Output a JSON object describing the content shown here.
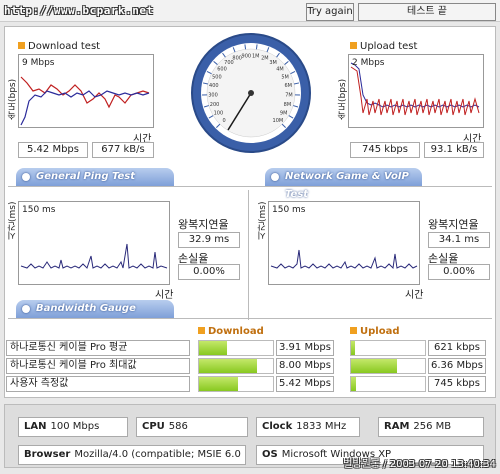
{
  "header": {
    "url": "http://www.bcpark.net",
    "try_again": "Try again",
    "test_end": "테스트 끝"
  },
  "download": {
    "title": "Download test",
    "axis_unit": "속도(bps)",
    "scale_label": "9 Mbps",
    "time_label": "시간",
    "mbps": "5.42 Mbps",
    "kbs": "677 kB/s"
  },
  "upload": {
    "title": "Upload test",
    "axis_unit": "속도(bps)",
    "scale_label": "2 Mbps",
    "time_label": "시간",
    "kbps": "745 kbps",
    "kbs": "93.1 kB/s"
  },
  "gauge": {
    "ticks": [
      "0",
      "100",
      "200",
      "300",
      "400",
      "500",
      "600",
      "700",
      "800",
      "900",
      "1M",
      "2M",
      "3M",
      "4M",
      "5M",
      "6M",
      "7M",
      "8M",
      "9M",
      "10M"
    ],
    "needle_value": "5M"
  },
  "ping": {
    "tab_label": "General Ping Test",
    "axis_unit": "시간(ms)",
    "scale_label": "150 ms",
    "time_label": "시간",
    "rtt_label": "왕복지연율",
    "rtt_value": "32.9 ms",
    "loss_label": "손실율",
    "loss_value": "0.00%"
  },
  "game": {
    "tab_label": "Network Game & VoIP Test",
    "axis_unit": "시간(ms)",
    "scale_label": "150 ms",
    "time_label": "시간",
    "rtt_label": "왕복지연율",
    "rtt_value": "34.1 ms",
    "loss_label": "손실율",
    "loss_value": "0.00%"
  },
  "bandwidth": {
    "tab_label": "Bandwidth Gauge",
    "download_header": "Download",
    "upload_header": "Upload",
    "rows": [
      {
        "label": "하나로통신 케이블 Pro 평균",
        "down": "3.91 Mbps",
        "down_fill": 0.38,
        "up": "621 kbps",
        "up_fill": 0.06
      },
      {
        "label": "하나로통신 케이블 Pro 최대값",
        "down": "8.00 Mbps",
        "down_fill": 0.78,
        "up": "6.36 Mbps",
        "up_fill": 0.62
      },
      {
        "label": "사용자 측정값",
        "down": "5.42 Mbps",
        "down_fill": 0.53,
        "up": "745 kbps",
        "up_fill": 0.07
      }
    ]
  },
  "system": {
    "lan_label": "LAN",
    "lan_value": "100 Mbps",
    "cpu_label": "CPU",
    "cpu_value": "586",
    "clock_label": "Clock",
    "clock_value": "1833 MHz",
    "ram_label": "RAM",
    "ram_value": "256 MB",
    "browser_label": "Browser",
    "browser_value": "Mozilla/4.0 (compatible; MSIE 6.0",
    "os_label": "OS",
    "os_value": "Microsoft Windows XP"
  },
  "footer": {
    "stamp": "벌방원롱 / 2003-07-20 13:40:34"
  },
  "colors": {
    "tab_blue": "#7e9fd8",
    "download_line": "#c02020",
    "upload_line": "#2a2a9a",
    "ping_line": "#2a2a7a",
    "bar_green": "#88c820",
    "section_orange": "#f0a020"
  }
}
